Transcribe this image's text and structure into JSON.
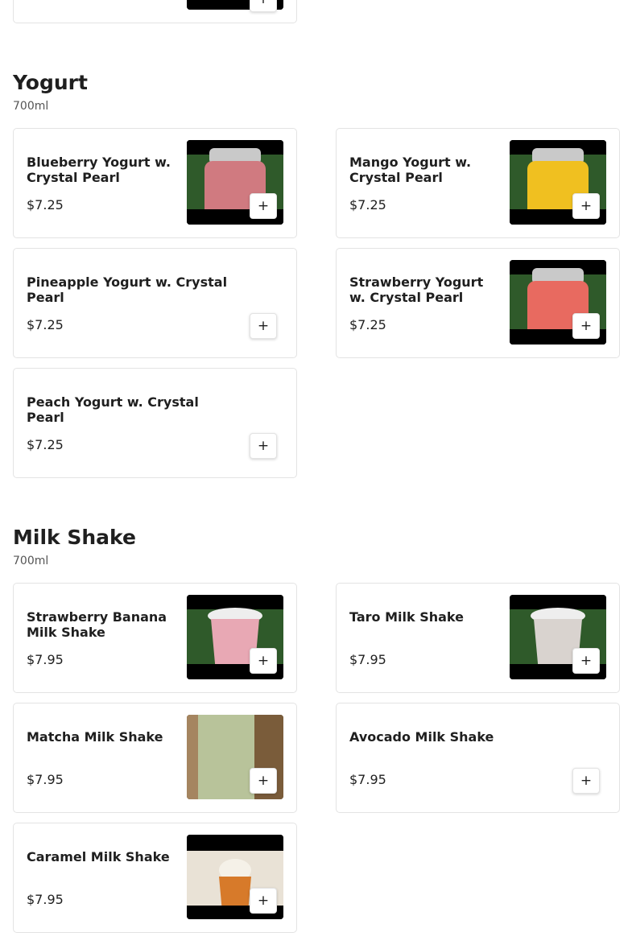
{
  "prev_section": {
    "add_label": "+"
  },
  "sections": [
    {
      "title": "Yogurt",
      "subtitle": "700ml",
      "items": [
        {
          "name": "Blueberry Yogurt w. Crystal Pearl",
          "price": "$7.25",
          "add_label": "+",
          "image": "blueberry-yogurt-jar-photo"
        },
        {
          "name": "Mango Yogurt w. Crystal Pearl",
          "price": "$7.25",
          "add_label": "+",
          "image": "mango-yogurt-jar-photo"
        },
        {
          "name": "Pineapple Yogurt w. Crystal Pearl",
          "price": "$7.25",
          "add_label": "+"
        },
        {
          "name": "Strawberry Yogurt w. Crystal Pearl",
          "price": "$7.25",
          "add_label": "+",
          "image": "strawberry-yogurt-jar-photo"
        },
        {
          "name": "Peach Yogurt w. Crystal Pearl",
          "price": "$7.25",
          "add_label": "+"
        }
      ]
    },
    {
      "title": "Milk Shake",
      "subtitle": "700ml",
      "items": [
        {
          "name": "Strawberry Banana Milk Shake",
          "price": "$7.95",
          "add_label": "+",
          "image": "strawberry-banana-shake-cup-photo"
        },
        {
          "name": "Taro Milk Shake",
          "price": "$7.95",
          "add_label": "+",
          "image": "taro-shake-cup-photo"
        },
        {
          "name": "Matcha Milk Shake",
          "price": "$7.95",
          "add_label": "+",
          "image": "matcha-shake-cup-photo"
        },
        {
          "name": "Avocado Milk Shake",
          "price": "$7.95",
          "add_label": "+"
        },
        {
          "name": "Caramel Milk Shake",
          "price": "$7.95",
          "add_label": "+",
          "image": "caramel-shake-cup-photo"
        }
      ]
    }
  ],
  "colors": {
    "text": "#1f1f1f",
    "border": "#e3e3e3",
    "blueberry": "#d07a80",
    "mango": "#f0c020",
    "strawberry": "#e86a60",
    "grass": "#2f5a2a",
    "matcha": "#b8c39a",
    "caramel": "#d77a2a"
  }
}
